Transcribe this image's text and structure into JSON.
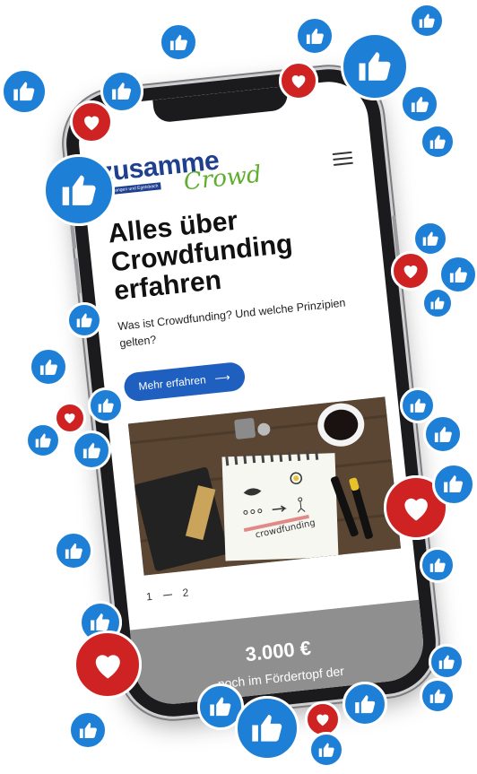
{
  "brand": {
    "name_main": "zusamme",
    "name_script": "Crowd",
    "tagline": "Für Langen und Egelsbach"
  },
  "hero": {
    "headline_lines": [
      "Alles über",
      "Crowdfunding",
      "erfahren"
    ],
    "subtext": "Was ist Crowdfunding? Und welche Prinzipien gelten?",
    "cta_label": "Mehr erfahren",
    "cta_arrow": "⟶",
    "image_caption": "crowdfunding"
  },
  "pager": {
    "current": "1",
    "total": "2"
  },
  "funding": {
    "amount": "3.000 €",
    "label": "noch im Fördertopf der"
  },
  "colors": {
    "brand_blue": "#1f3f8f",
    "brand_green": "#5fae2e",
    "cta_blue": "#1f5fbf",
    "like_blue": "#1e7fd6",
    "heart_red": "#cf2222",
    "panel_gray": "#8f8f8f"
  },
  "icons": [
    "thumbs-up-icon",
    "heart-icon",
    "hamburger-menu-icon",
    "arrow-right-icon"
  ]
}
